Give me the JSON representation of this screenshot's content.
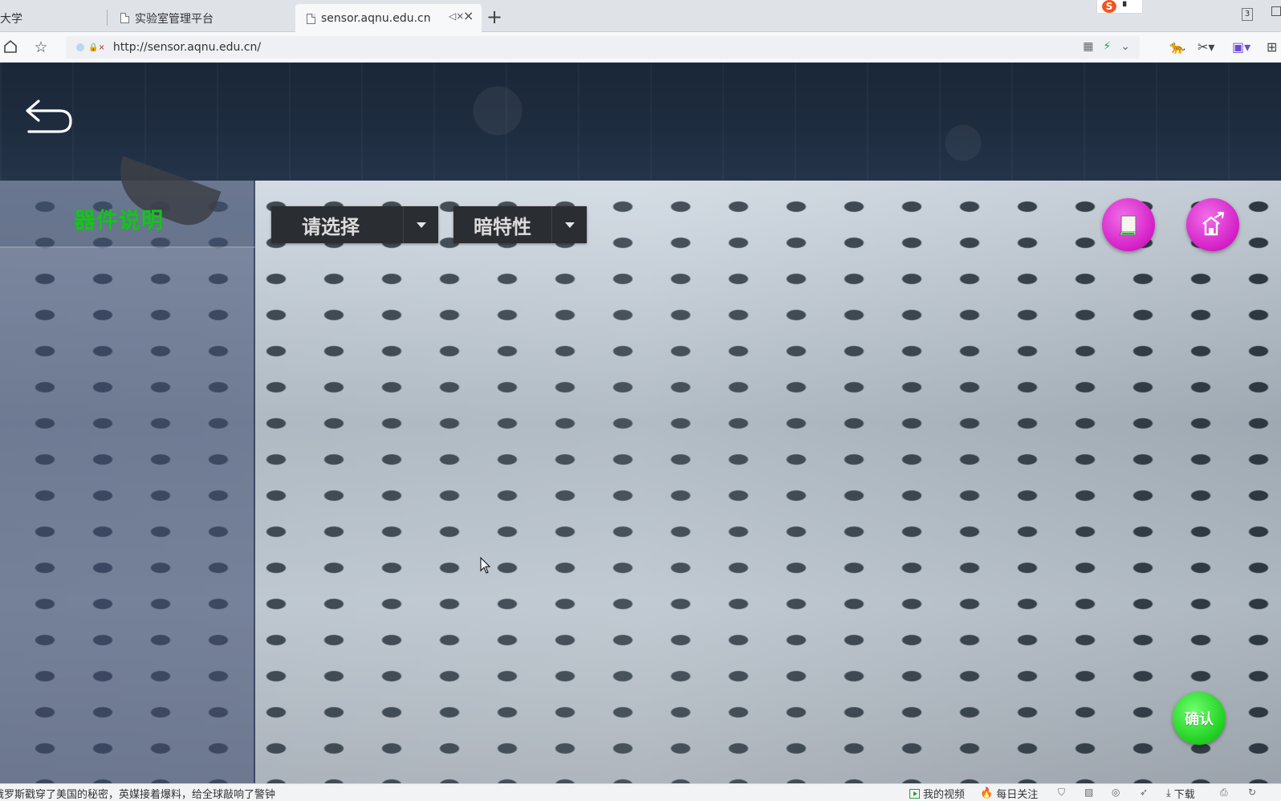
{
  "browser": {
    "tabs": [
      {
        "label": "大学",
        "active": false
      },
      {
        "label": "实验室管理平台",
        "active": false
      },
      {
        "label": "sensor.aqnu.edu.cn",
        "active": true
      }
    ],
    "tab_count": "3",
    "address": {
      "url": "http://sensor.aqnu.edu.cn/"
    }
  },
  "app": {
    "panel_title": "器件说明",
    "dropdown_component": {
      "value": "请选择"
    },
    "dropdown_property": {
      "value": "暗特性"
    },
    "confirm_label": "确认",
    "colors": {
      "title_green": "#19c219",
      "action_magenta": "#d41ec6",
      "confirm_green": "#24d224",
      "dropdown_bg": "#2a2d31"
    },
    "icons": [
      "back-arrow-icon",
      "book-icon",
      "home-export-icon"
    ]
  },
  "statusbar": {
    "news": "俄罗斯戳穿了美国的秘密，英媒接着爆料，给全球敲响了警钟",
    "my_videos": "我的视频",
    "daily_follow": "每日关注",
    "download": "下载"
  }
}
